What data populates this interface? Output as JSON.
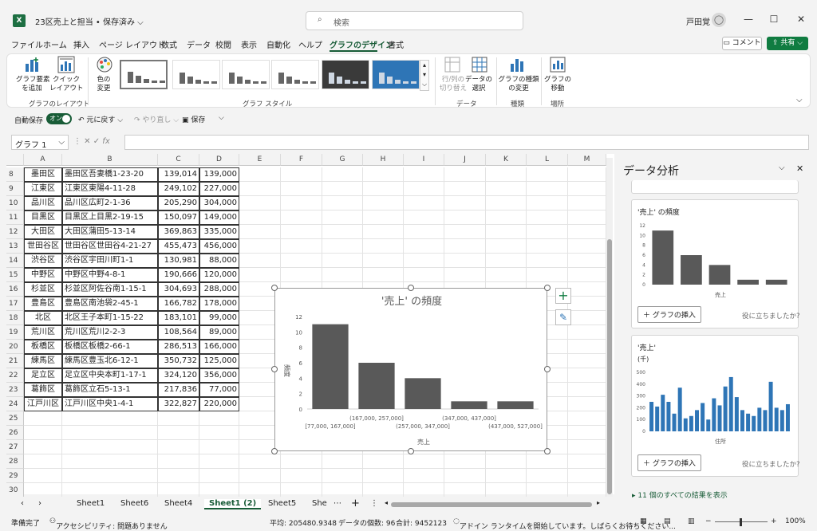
{
  "app": {
    "title": "23区売上と担当 • 保存済み ⌵",
    "search_placeholder": "検索",
    "user": "戸田覚",
    "logo": "X"
  },
  "menu": [
    "ファイル",
    "ホーム",
    "挿入",
    "ページ レイアウト",
    "数式",
    "データ",
    "校閲",
    "表示",
    "自動化",
    "ヘルプ",
    "グラフのデザイン",
    "書式"
  ],
  "menu_active": "グラフのデザイン",
  "header_buttons": {
    "comment": "コメント",
    "share": "共有"
  },
  "ribbon": {
    "add_element": "グラフ要素\nを追加",
    "quick_layout": "クイック\nレイアウト",
    "change_color": "色の\n変更",
    "group_layout": "グラフのレイアウト",
    "group_style": "グラフ スタイル",
    "swap_rowcol": "行/列の\n切り替え",
    "select_data": "データの\n選択",
    "group_data": "データ",
    "change_type": "グラフの種類\nの変更",
    "group_type": "種類",
    "move_chart": "グラフの\n移動",
    "group_location": "場所"
  },
  "qat": {
    "autosave": "自動保存",
    "toggle": "オン",
    "undo": "元に戻す",
    "redo": "やり直し",
    "save": "保存"
  },
  "namebox": "グラフ 1",
  "columns": [
    "A",
    "B",
    "C",
    "D",
    "E",
    "F",
    "G",
    "H",
    "I",
    "J",
    "K",
    "L",
    "M"
  ],
  "rows": [
    {
      "n": "8",
      "ward": "墨田区",
      "addr": "墨田区吾妻橋1-23-20",
      "c": "139,014",
      "d": "139,000"
    },
    {
      "n": "9",
      "ward": "江東区",
      "addr": "江東区東陽4-11-28",
      "c": "249,102",
      "d": "227,000"
    },
    {
      "n": "10",
      "ward": "品川区",
      "addr": "品川区広町2-1-36",
      "c": "205,290",
      "d": "304,000"
    },
    {
      "n": "11",
      "ward": "目黒区",
      "addr": "目黒区上目黒2-19-15",
      "c": "150,097",
      "d": "149,000"
    },
    {
      "n": "12",
      "ward": "大田区",
      "addr": "大田区蒲田5-13-14",
      "c": "369,863",
      "d": "335,000"
    },
    {
      "n": "13",
      "ward": "世田谷区",
      "addr": "世田谷区世田谷4-21-27",
      "c": "455,473",
      "d": "456,000"
    },
    {
      "n": "14",
      "ward": "渋谷区",
      "addr": "渋谷区宇田川町1-1",
      "c": "130,981",
      "d": "88,000"
    },
    {
      "n": "15",
      "ward": "中野区",
      "addr": "中野区中野4-8-1",
      "c": "190,666",
      "d": "120,000"
    },
    {
      "n": "16",
      "ward": "杉並区",
      "addr": "杉並区阿佐谷南1-15-1",
      "c": "304,693",
      "d": "288,000"
    },
    {
      "n": "17",
      "ward": "豊島区",
      "addr": "豊島区南池袋2-45-1",
      "c": "166,782",
      "d": "178,000"
    },
    {
      "n": "18",
      "ward": "北区",
      "addr": "北区王子本町1-15-22",
      "c": "183,101",
      "d": "99,000"
    },
    {
      "n": "19",
      "ward": "荒川区",
      "addr": "荒川区荒川2-2-3",
      "c": "108,564",
      "d": "89,000"
    },
    {
      "n": "20",
      "ward": "板橋区",
      "addr": "板橋区板橋2-66-1",
      "c": "286,513",
      "d": "166,000"
    },
    {
      "n": "21",
      "ward": "練馬区",
      "addr": "練馬区豊玉北6-12-1",
      "c": "350,732",
      "d": "125,000"
    },
    {
      "n": "22",
      "ward": "足立区",
      "addr": "足立区中央本町1-17-1",
      "c": "324,120",
      "d": "356,000"
    },
    {
      "n": "23",
      "ward": "葛飾区",
      "addr": "葛飾区立石5-13-1",
      "c": "217,836",
      "d": "77,000"
    },
    {
      "n": "24",
      "ward": "江戸川区",
      "addr": "江戸川区中央1-4-1",
      "c": "322,827",
      "d": "220,000"
    }
  ],
  "empty_rows": [
    "25",
    "26",
    "27",
    "28",
    "29",
    "30"
  ],
  "chart_data": {
    "type": "bar",
    "title": "'売上' の頻度",
    "xlabel": "売上",
    "ylabel": "頻度",
    "categories": [
      "[77,000, 167,000]",
      "(167,000, 257,000]",
      "(257,000, 347,000]",
      "(347,000, 437,000]",
      "(437,000, 527,000]"
    ],
    "values": [
      11,
      6,
      4,
      1,
      1
    ],
    "ylim": [
      0,
      12
    ],
    "yticks": [
      "12",
      "10",
      "8",
      "6",
      "4",
      "2",
      "0"
    ],
    "bar_color": "#595959"
  },
  "pane": {
    "title": "データ分析",
    "card1_title": "'売上' の頻度",
    "card1_xlabel": "売上",
    "card1_yticks": [
      "12",
      "10",
      "8",
      "6",
      "4",
      "2",
      "0"
    ],
    "card1_values": [
      11,
      6,
      4,
      1,
      1
    ],
    "insert": "グラフの挿入",
    "helpful": "役に立ちましたか?",
    "card2_title": "'売上'",
    "card2_unit": "(千)",
    "card2_yticks": [
      "500",
      "400",
      "300",
      "200",
      "100",
      "0"
    ],
    "card2_xlabel": "住所",
    "card2_values": [
      250,
      210,
      310,
      250,
      150,
      370,
      110,
      130,
      180,
      240,
      100,
      280,
      220,
      380,
      460,
      290,
      180,
      150,
      130,
      200,
      180,
      420,
      200,
      180,
      230
    ],
    "card2_color": "#2e75b6",
    "more": "11 個のすべての結果を表示"
  },
  "sheets": [
    "Sheet1",
    "Sheet6",
    "Sheet4",
    "Sheet1 (2)",
    "Sheet5",
    "She"
  ],
  "sheet_active": "Sheet1 (2)",
  "status": {
    "ready": "準備完了",
    "accessibility": "アクセシビリティ: 問題ありません",
    "average": "平均: 205480.9348",
    "count": "データの個数: 96",
    "sum": "合計: 9452123",
    "addin": "アドイン ランタイムを開始しています。しばらくお待ちください...",
    "zoom": "100%"
  }
}
